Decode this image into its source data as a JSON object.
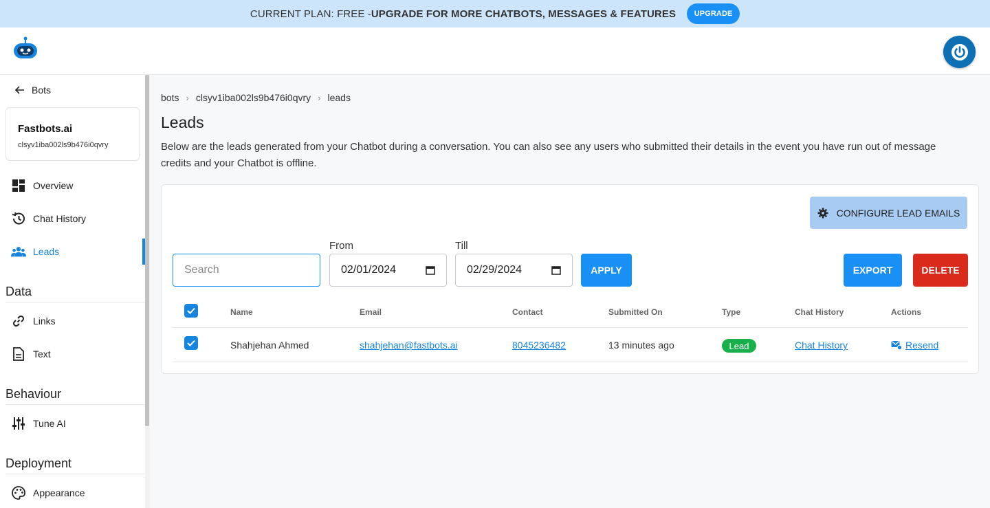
{
  "banner": {
    "plain": "CURRENT PLAN: FREE - ",
    "bold": "UPGRADE FOR MORE CHATBOTS, MESSAGES & FEATURES",
    "button": "UPGRADE"
  },
  "colors": {
    "accent": "#1890f5",
    "active": "#1685e0",
    "danger": "#d92a1b",
    "success": "#19b04c",
    "banner_bg": "#cde5fb"
  },
  "sidebar": {
    "back_label": "Bots",
    "bot": {
      "name": "Fastbots.ai",
      "id": "clsyv1iba002ls9b476i0qvry"
    },
    "items": [
      {
        "label": "Overview",
        "icon": "dashboard-icon"
      },
      {
        "label": "Chat History",
        "icon": "history-icon"
      },
      {
        "label": "Leads",
        "icon": "people-icon",
        "active": true
      }
    ],
    "sections": [
      {
        "title": "Data",
        "items": [
          {
            "label": "Links",
            "icon": "link-icon"
          },
          {
            "label": "Text",
            "icon": "document-icon"
          }
        ]
      },
      {
        "title": "Behaviour",
        "items": [
          {
            "label": "Tune AI",
            "icon": "tune-icon"
          }
        ]
      },
      {
        "title": "Deployment",
        "items": [
          {
            "label": "Appearance",
            "icon": "palette-icon"
          }
        ]
      }
    ]
  },
  "breadcrumb": [
    "bots",
    "clsyv1iba002ls9b476i0qvry",
    "leads"
  ],
  "page": {
    "title": "Leads",
    "description": "Below are the leads generated from your Chatbot during a conversation. You can also see any users who submitted their details in the event you have run out of message credits and your Chatbot is offline."
  },
  "toolbar": {
    "configure_label": "CONFIGURE LEAD EMAILS",
    "search_placeholder": "Search",
    "from_label": "From",
    "from_value": "02/01/2024",
    "till_label": "Till",
    "till_value": "02/29/2024",
    "apply_label": "APPLY",
    "export_label": "EXPORT",
    "delete_label": "DELETE"
  },
  "table": {
    "columns": [
      "Name",
      "Email",
      "Contact",
      "Submitted On",
      "Type",
      "Chat History",
      "Actions"
    ],
    "rows": [
      {
        "checked": true,
        "name": "Shahjehan Ahmed",
        "email": "shahjehan@fastbots.ai",
        "contact": "8045236482",
        "submitted": "13 minutes ago",
        "type": "Lead",
        "chat_history": "Chat History",
        "action": "Resend"
      }
    ]
  }
}
